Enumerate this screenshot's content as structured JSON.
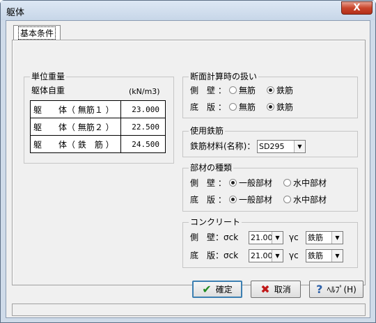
{
  "window": {
    "title": "躯体",
    "close_glyph": "X"
  },
  "tab": {
    "label": "基本条件"
  },
  "unit_weight": {
    "title": "単位重量",
    "subtitle": "躯体自重",
    "unit": "(kN/m3)",
    "rows": [
      {
        "label": "躯　　体（ 無筋１ ）",
        "value": "23.000"
      },
      {
        "label": "躯　　体（ 無筋２ ）",
        "value": "22.500"
      },
      {
        "label": "躯　　体（ 鉄　筋 ）",
        "value": "24.500"
      }
    ]
  },
  "section_calc": {
    "title": "断面計算時の扱い",
    "side_wall": {
      "label": "側　壁 ：",
      "options": [
        "無筋",
        "鉄筋"
      ],
      "selected": "鉄筋"
    },
    "bottom_slab": {
      "label": "底　版 ：",
      "options": [
        "無筋",
        "鉄筋"
      ],
      "selected": "鉄筋"
    }
  },
  "rebar": {
    "title": "使用鉄筋",
    "material_label": "鉄筋材料(名称)：",
    "material_value": "SD295"
  },
  "member_type": {
    "title": "部材の種類",
    "side_wall": {
      "label": "側　壁 ：",
      "options": [
        "一般部材",
        "水中部材"
      ],
      "selected": "一般部材"
    },
    "bottom_slab": {
      "label": "底　版 ：",
      "options": [
        "一般部材",
        "水中部材"
      ],
      "selected": "一般部材"
    }
  },
  "concrete": {
    "title": "コンクリート",
    "side_wall": {
      "label": "側　壁：σck",
      "sigma_value": "21.00",
      "gamma_label": "γc",
      "gamma_value": "鉄筋"
    },
    "bottom_slab": {
      "label": "底　版：σck",
      "sigma_value": "21.00",
      "gamma_label": "γc",
      "gamma_value": "鉄筋"
    }
  },
  "buttons": {
    "ok": {
      "label": "確定",
      "icon": "check-icon"
    },
    "cancel": {
      "label": "取消",
      "icon": "x-icon"
    },
    "help": {
      "label": "ﾍﾙﾌﾟ(H)",
      "icon": "question-icon"
    }
  }
}
